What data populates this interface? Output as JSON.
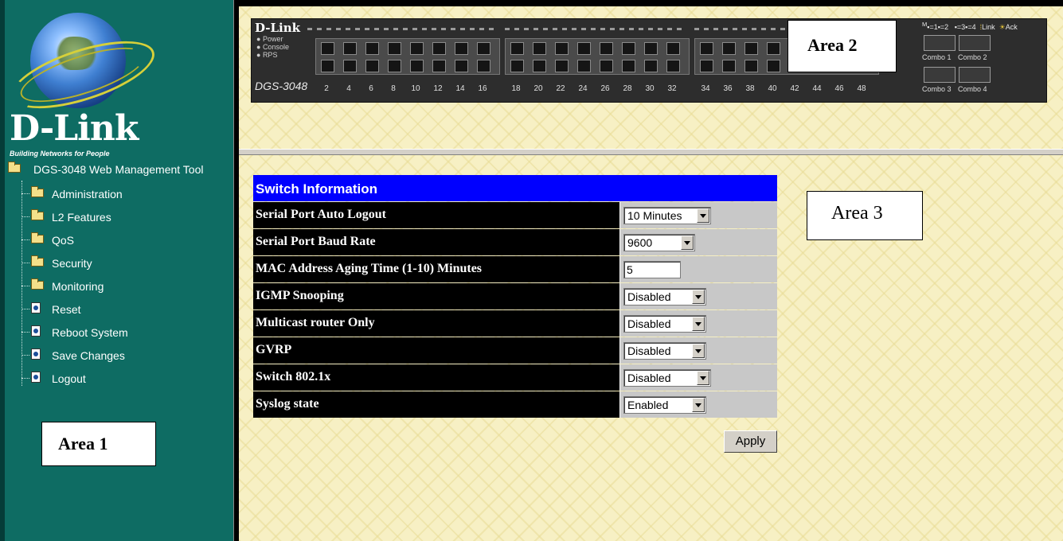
{
  "sidebar": {
    "logo": {
      "brand": "D-Link",
      "tagline": "Building Networks for People"
    },
    "tree": {
      "root_label": "DGS-3048 Web Management Tool",
      "items": [
        {
          "label": "Administration",
          "icon": "folder-icon"
        },
        {
          "label": "L2 Features",
          "icon": "folder-icon"
        },
        {
          "label": "QoS",
          "icon": "folder-icon"
        },
        {
          "label": "Security",
          "icon": "folder-icon"
        },
        {
          "label": "Monitoring",
          "icon": "folder-icon"
        },
        {
          "label": "Reset",
          "icon": "page-icon"
        },
        {
          "label": "Reboot System",
          "icon": "page-icon"
        },
        {
          "label": "Save Changes",
          "icon": "page-icon"
        },
        {
          "label": "Logout",
          "icon": "page-icon"
        }
      ]
    },
    "area_label": "Area 1"
  },
  "device_panel": {
    "brand": "D-Link",
    "leds": [
      "Power",
      "Console",
      "RPS"
    ],
    "model": "DGS-3048",
    "port_numbers": [
      "2",
      "4",
      "6",
      "8",
      "10",
      "12",
      "14",
      "16",
      "18",
      "20",
      "22",
      "24",
      "26",
      "28",
      "30",
      "32",
      "34",
      "36",
      "38",
      "40",
      "42",
      "44",
      "46",
      "48"
    ],
    "legend": {
      "m": "M",
      "items": [
        "1",
        "2",
        "3",
        "4"
      ],
      "link": "Link",
      "ack": "Ack"
    },
    "combo_ports": [
      "Combo 1",
      "Combo 2",
      "Combo 3",
      "Combo 4"
    ],
    "area_label": "Area 2"
  },
  "switch_info": {
    "title": "Switch Information",
    "rows": [
      {
        "label": "Serial Port Auto Logout",
        "value": "10 Minutes"
      },
      {
        "label": "Serial Port Baud Rate",
        "value": "9600"
      },
      {
        "label": "MAC Address Aging Time (1-10) Minutes",
        "value": "5"
      },
      {
        "label": "IGMP Snooping",
        "value": "Disabled"
      },
      {
        "label": "Multicast router Only",
        "value": "Disabled"
      },
      {
        "label": "GVRP",
        "value": "Disabled"
      },
      {
        "label": "Switch 802.1x",
        "value": "Disabled"
      },
      {
        "label": "Syslog state",
        "value": "Enabled"
      }
    ],
    "apply_label": "Apply",
    "area_label": "Area 3"
  },
  "colors": {
    "sidebar_bg": "#0e6c63",
    "title_bar": "#0000ff",
    "row_label_bg": "#000000",
    "pane_bg": "#f7f0c4"
  }
}
